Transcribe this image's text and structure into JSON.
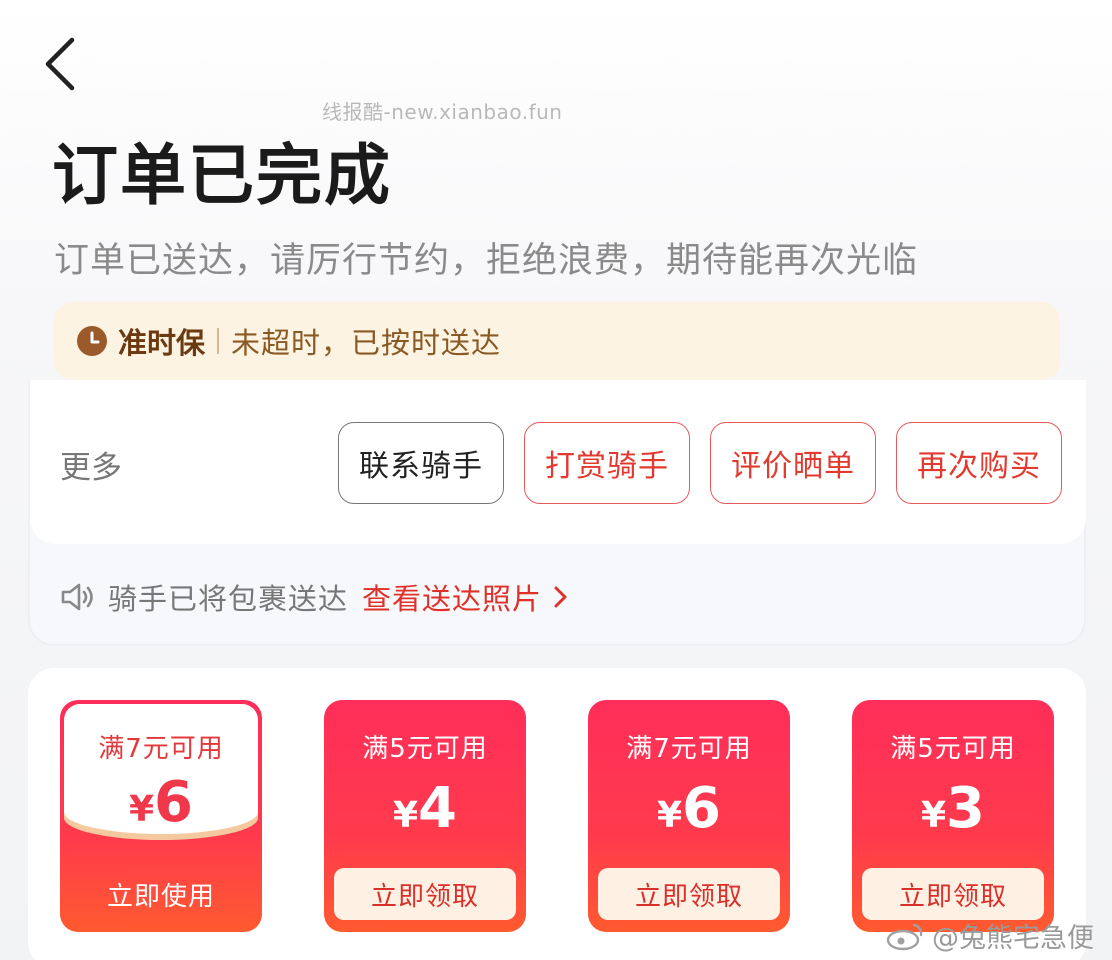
{
  "watermark": "线报酷-new.xianbao.fun",
  "page_title": "订单已完成",
  "subtitle": "订单已送达，请厉行节约，拒绝浪费，期待能再次光临",
  "ontime": {
    "label": "准时保",
    "text": "未超时，已按时送达"
  },
  "actions": {
    "more_label": "更多",
    "buttons": [
      "联系骑手",
      "打赏骑手",
      "评价晒单",
      "再次购买"
    ]
  },
  "rider_notice": {
    "text": "骑手已将包裹送达",
    "link": "查看送达照片"
  },
  "coupons": [
    {
      "condition": "满7元可用",
      "currency": "¥",
      "amount": "6",
      "action": "立即使用",
      "state": "owned"
    },
    {
      "condition": "满5元可用",
      "currency": "¥",
      "amount": "4",
      "action": "立即领取",
      "state": "available"
    },
    {
      "condition": "满7元可用",
      "currency": "¥",
      "amount": "6",
      "action": "立即领取",
      "state": "available"
    },
    {
      "condition": "满5元可用",
      "currency": "¥",
      "amount": "3",
      "action": "立即领取",
      "state": "available"
    }
  ],
  "weibo_watermark": "@兔熊宅急便",
  "colors": {
    "accent_red": "#e33a2f",
    "ontime_bg": "#fdf3e3",
    "coupon_red": "#ff2e5a"
  },
  "icons": [
    "back-arrow-icon",
    "clock-icon",
    "speaker-icon",
    "chevron-right-icon",
    "weibo-icon"
  ]
}
